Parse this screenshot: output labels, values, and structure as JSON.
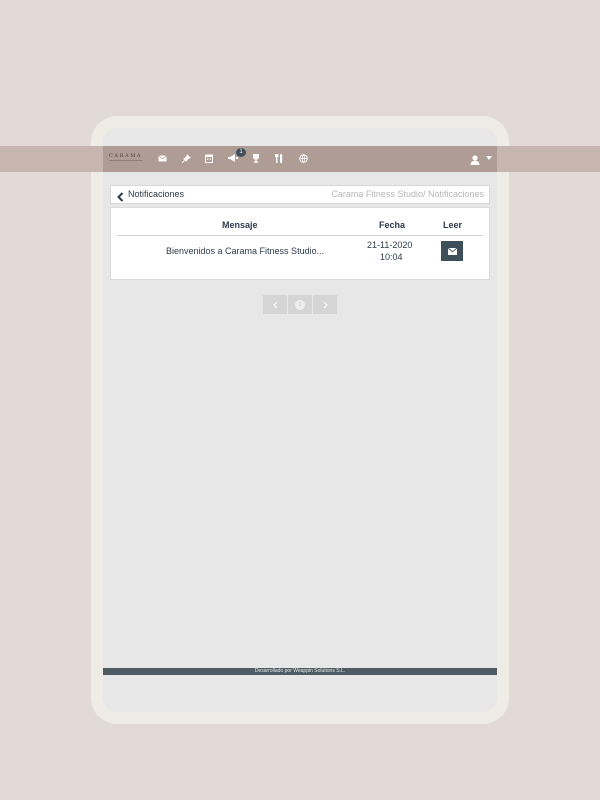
{
  "brand": {
    "logo_text": "CARAMA",
    "logo_tagline": "fitness studio"
  },
  "header": {
    "nav_icons": [
      "mail-icon",
      "pin-icon",
      "calendar-icon",
      "megaphone-icon",
      "trophy-icon",
      "food-icon",
      "globe-icon"
    ],
    "notification_count": "1"
  },
  "breadcrumb": {
    "title": "Notificaciones",
    "path": "Carama Fitness Studio/ Notificaciones"
  },
  "table": {
    "headers": {
      "message": "Mensaje",
      "date": "Fecha",
      "read": "Leer"
    },
    "rows": [
      {
        "message": "Bienvenidos a Carama Fitness Studio...",
        "date": "21-11-2020",
        "time": "10:04"
      }
    ]
  },
  "pager": {
    "prev": "‹",
    "current": "1",
    "next": "›"
  },
  "footer": {
    "text": "Desarrollado por Weappin Solutions S.L."
  },
  "colors": {
    "topbar": "#ae9c95",
    "accent": "#3e4f5c",
    "background": "#e3dad6"
  }
}
